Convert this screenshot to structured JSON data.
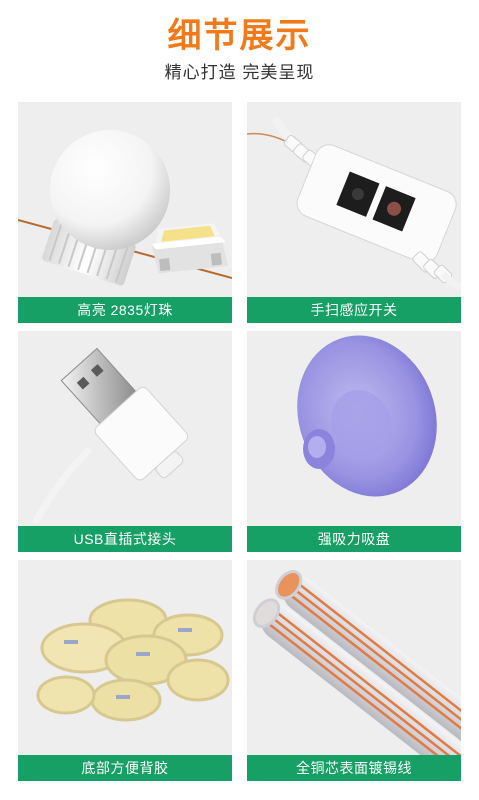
{
  "header": {
    "title": "细节展示",
    "subtitle": "精心打造 完美呈现"
  },
  "colors": {
    "title": "#f27a1b",
    "label_bar": "#17a065",
    "card_background": "#eeeeee"
  },
  "cards": [
    {
      "label": "高亮 2835灯珠",
      "image": "led-bulb-image"
    },
    {
      "label": "手扫感应开关",
      "image": "hand-sweep-sensor-switch-image"
    },
    {
      "label": "USB直插式接头",
      "image": "usb-plug-image"
    },
    {
      "label": "强吸力吸盘",
      "image": "suction-cup-image"
    },
    {
      "label": "底部方便背胶",
      "image": "adhesive-pads-image"
    },
    {
      "label": "全铜芯表面镀锡线",
      "image": "tinned-copper-wire-image"
    }
  ]
}
